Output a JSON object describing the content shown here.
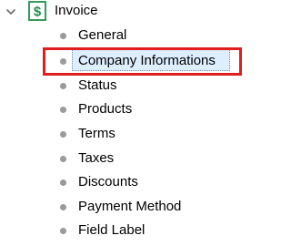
{
  "tree": {
    "root": {
      "label": "Invoice",
      "expanded": true,
      "icon": "dollar-document-icon",
      "toggle_icon": "chevron-down-icon"
    },
    "children": [
      {
        "label": "General",
        "selected": false
      },
      {
        "label": "Company Informations",
        "selected": true
      },
      {
        "label": "Status",
        "selected": false
      },
      {
        "label": "Products",
        "selected": false
      },
      {
        "label": "Terms",
        "selected": false
      },
      {
        "label": "Taxes",
        "selected": false
      },
      {
        "label": "Discounts",
        "selected": false
      },
      {
        "label": "Payment Method",
        "selected": false
      },
      {
        "label": "Field Label",
        "selected": false
      }
    ]
  },
  "colors": {
    "highlight": "#e11e1e",
    "selection_fill": "#ddeefe",
    "icon_green": "#1f8f4a",
    "bullet": "#9a9a9a"
  }
}
